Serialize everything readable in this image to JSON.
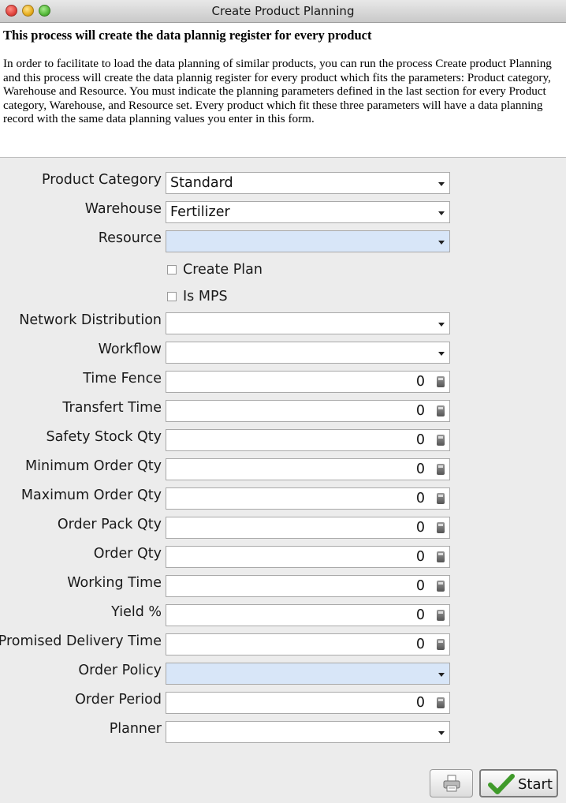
{
  "window": {
    "title": "Create Product Planning"
  },
  "header": {
    "title": "This process will create the data plannig register for every product",
    "description": "In order to facilitate to load the data planning of similar products, you can run the process Create product Planning and this process will create the data plannig register for every product which fits the parameters: Product category, Warehouse and Resource. You must indicate the planning parameters defined in the last section for every Product category, Warehouse, and Resource set. Every product which fit these three parameters will have a data planning record with the same data planning values you enter in this form."
  },
  "form": {
    "product_category": {
      "label": "Product Category",
      "value": "Standard"
    },
    "warehouse": {
      "label": "Warehouse",
      "value": "Fertilizer"
    },
    "resource": {
      "label": "Resource",
      "value": ""
    },
    "create_plan": {
      "label": "Create Plan",
      "checked": false
    },
    "is_mps": {
      "label": "Is MPS",
      "checked": false
    },
    "network_distribution": {
      "label": "Network Distribution",
      "value": ""
    },
    "workflow": {
      "label": "Workflow",
      "value": ""
    },
    "time_fence": {
      "label": "Time Fence",
      "value": "0"
    },
    "transfert_time": {
      "label": "Transfert Time",
      "value": "0"
    },
    "safety_stock_qty": {
      "label": "Safety Stock Qty",
      "value": "0"
    },
    "minimum_order_qty": {
      "label": "Minimum Order Qty",
      "value": "0"
    },
    "maximum_order_qty": {
      "label": "Maximum Order Qty",
      "value": "0"
    },
    "order_pack_qty": {
      "label": "Order Pack Qty",
      "value": "0"
    },
    "order_qty": {
      "label": "Order Qty",
      "value": "0"
    },
    "working_time": {
      "label": "Working Time",
      "value": "0"
    },
    "yield": {
      "label": "Yield %",
      "value": "0"
    },
    "promised_delivery_time": {
      "label": "Promised Delivery Time",
      "value": "0"
    },
    "order_policy": {
      "label": "Order Policy",
      "value": ""
    },
    "order_period": {
      "label": "Order Period",
      "value": "0"
    },
    "planner": {
      "label": "Planner",
      "value": ""
    }
  },
  "buttons": {
    "start": "Start"
  },
  "icons": {
    "print": "printer-icon",
    "start": "checkmark-icon",
    "calculator": "calculator-icon",
    "dropdown": "chevron-down-icon"
  },
  "colors": {
    "highlight_field": "#d8e6f8",
    "accent_check": "#3f9a2a"
  }
}
